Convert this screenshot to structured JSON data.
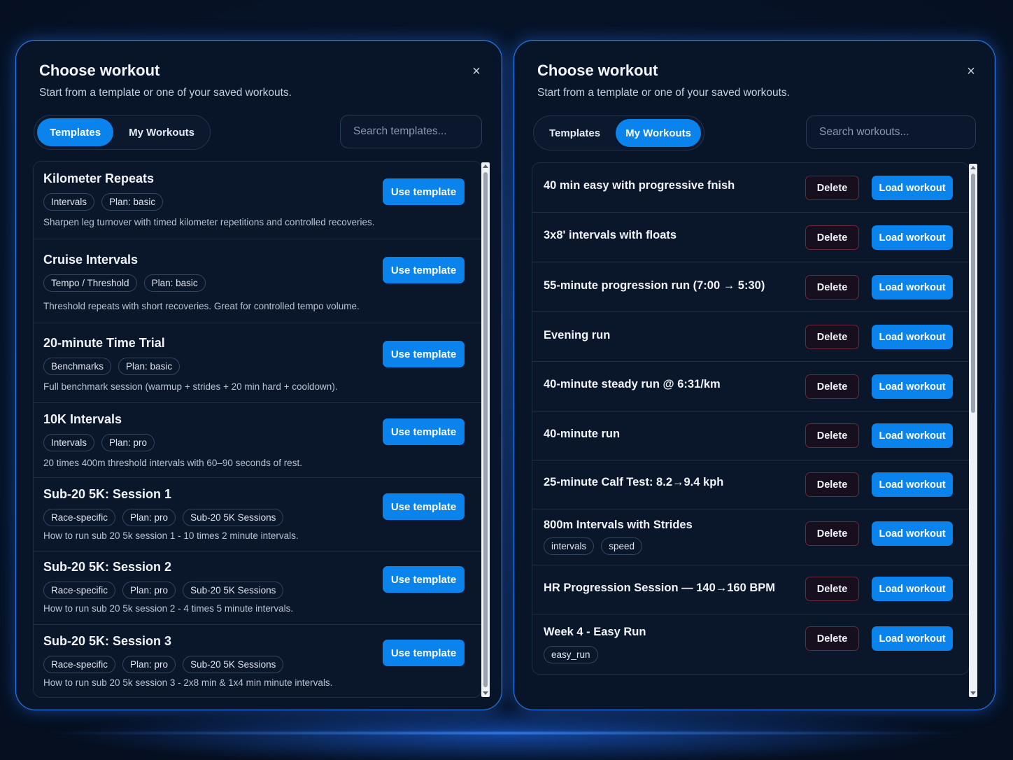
{
  "left": {
    "title": "Choose workout",
    "subtitle": "Start from a template or one of your saved workouts.",
    "close_glyph": "×",
    "tabs": [
      {
        "label": "Templates",
        "active": true
      },
      {
        "label": "My Workouts",
        "active": false
      }
    ],
    "search_placeholder": "Search templates...",
    "use_label": "Use template",
    "templates": [
      {
        "title": "Kilometer Repeats",
        "tags": [
          "Intervals",
          "Plan: basic"
        ],
        "desc": "Sharpen leg turnover with timed kilometer repetitions and controlled recoveries."
      },
      {
        "title": "Cruise Intervals",
        "tags": [
          "Tempo / Threshold",
          "Plan: basic"
        ],
        "desc": "Threshold repeats with short recoveries. Great for controlled tempo volume."
      },
      {
        "title": "20-minute Time Trial",
        "tags": [
          "Benchmarks",
          "Plan: basic"
        ],
        "desc": "Full benchmark session (warmup + strides + 20 min hard + cooldown)."
      },
      {
        "title": "10K Intervals",
        "tags": [
          "Intervals",
          "Plan: pro"
        ],
        "desc": "20 times 400m threshold intervals with 60–90 seconds of rest."
      },
      {
        "title": "Sub-20 5K: Session 1",
        "tags": [
          "Race-specific",
          "Plan: pro",
          "Sub-20 5K Sessions"
        ],
        "desc": "How to run sub 20 5k session 1 - 10 times 2 minute intervals."
      },
      {
        "title": "Sub-20 5K: Session 2",
        "tags": [
          "Race-specific",
          "Plan: pro",
          "Sub-20 5K Sessions"
        ],
        "desc": "How to run sub 20 5k session 2 - 4 times 5 minute intervals."
      },
      {
        "title": "Sub-20 5K: Session 3",
        "tags": [
          "Race-specific",
          "Plan: pro",
          "Sub-20 5K Sessions"
        ],
        "desc": "How to run sub 20 5k session 3 - 2x8 min & 1x4 min minute intervals."
      }
    ]
  },
  "right": {
    "title": "Choose workout",
    "subtitle": "Start from a template or one of your saved workouts.",
    "close_glyph": "×",
    "tabs": [
      {
        "label": "Templates",
        "active": false
      },
      {
        "label": "My Workouts",
        "active": true
      }
    ],
    "search_placeholder": "Search workouts...",
    "delete_label": "Delete",
    "load_label": "Load workout",
    "workouts": [
      {
        "title": "40 min easy with progressive fnish",
        "tags": []
      },
      {
        "title": "3x8' intervals with floats",
        "tags": []
      },
      {
        "title": "55-minute progression run (7:00 → 5:30)",
        "tags": []
      },
      {
        "title": "Evening run",
        "tags": []
      },
      {
        "title": "40-minute steady run @ 6:31/km",
        "tags": []
      },
      {
        "title": "40-minute run",
        "tags": []
      },
      {
        "title": "25-minute Calf Test: 8.2→9.4 kph",
        "tags": []
      },
      {
        "title": "800m Intervals with Strides",
        "tags": [
          "intervals",
          "speed"
        ]
      },
      {
        "title": "HR Progression Session — 140→160 BPM",
        "tags": []
      },
      {
        "title": "Week 4 - Easy Run",
        "tags": [
          "easy_run"
        ]
      }
    ]
  }
}
